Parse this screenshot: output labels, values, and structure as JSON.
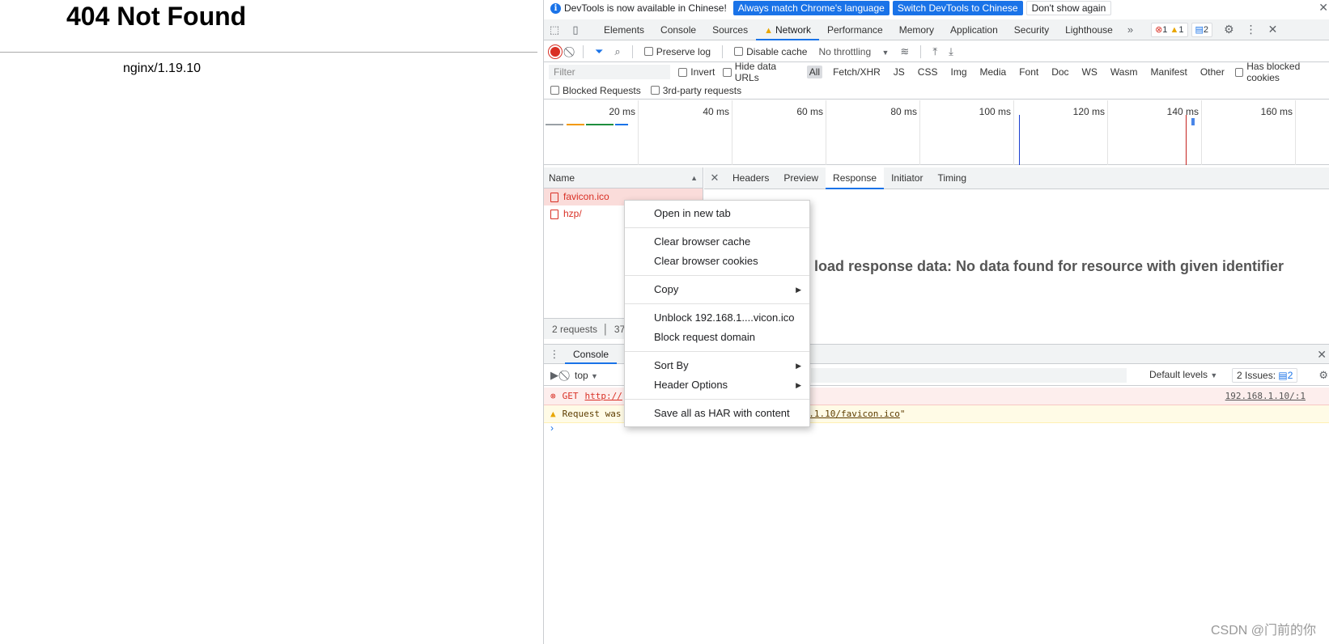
{
  "page": {
    "heading": "404 Not Found",
    "server": "nginx/1.19.10"
  },
  "infobar": {
    "message": "DevTools is now available in Chinese!",
    "match_button": "Always match Chrome's language",
    "switch_button": "Switch DevTools to Chinese",
    "dismiss_button": "Don't show again",
    "close": "✕"
  },
  "tabs": [
    "Elements",
    "Console",
    "Sources",
    "Network",
    "Performance",
    "Memory",
    "Application",
    "Security",
    "Lighthouse"
  ],
  "tabs_more": "»",
  "counts": {
    "errors": "1",
    "warnings": "1",
    "issues": "2"
  },
  "network_toolbar": {
    "preserve_log": "Preserve log",
    "disable_cache": "Disable cache",
    "throttling": "No throttling"
  },
  "filter_bar": {
    "placeholder": "Filter",
    "invert": "Invert",
    "hide_data_urls": "Hide data URLs",
    "types": [
      "All",
      "Fetch/XHR",
      "JS",
      "CSS",
      "Img",
      "Media",
      "Font",
      "Doc",
      "WS",
      "Wasm",
      "Manifest",
      "Other"
    ],
    "has_blocked_cookies": "Has blocked cookies",
    "blocked_requests": "Blocked Requests",
    "third_party": "3rd-party requests"
  },
  "overview_ticks": [
    "20 ms",
    "40 ms",
    "60 ms",
    "80 ms",
    "100 ms",
    "120 ms",
    "140 ms",
    "160 ms"
  ],
  "requests": {
    "header": "Name",
    "rows": [
      "favicon.ico",
      "hzp/"
    ],
    "status": "2 requests",
    "status_partial": "37"
  },
  "detail": {
    "tabs": [
      "Headers",
      "Preview",
      "Response",
      "Initiator",
      "Timing"
    ],
    "active_tab": "Response",
    "message": "Failed to load response data: No data found for resource with given identifier"
  },
  "drawer": {
    "tab": "Console"
  },
  "console": {
    "context": "top",
    "levels": "Default levels",
    "issues_label": "2 Issues:",
    "issues_count": "2",
    "error_method": "GET",
    "error_url": "http://",
    "error_source": "192.168.1.10/:1",
    "warning_prefix": "Request was",
    "warning_url": "68.1.10/favicon.ico",
    "warning_suffix": "\""
  },
  "context_menu": {
    "open_new_tab": "Open in new tab",
    "clear_cache": "Clear browser cache",
    "clear_cookies": "Clear browser cookies",
    "copy": "Copy",
    "unblock": "Unblock 192.168.1....vicon.ico",
    "block_domain": "Block request domain",
    "sort_by": "Sort By",
    "header_options": "Header Options",
    "save_har": "Save all as HAR with content"
  },
  "watermark": "CSDN @门前的你",
  "colors": {
    "accent": "#1a73e8",
    "error": "#d93025",
    "warning": "#e8a600"
  }
}
